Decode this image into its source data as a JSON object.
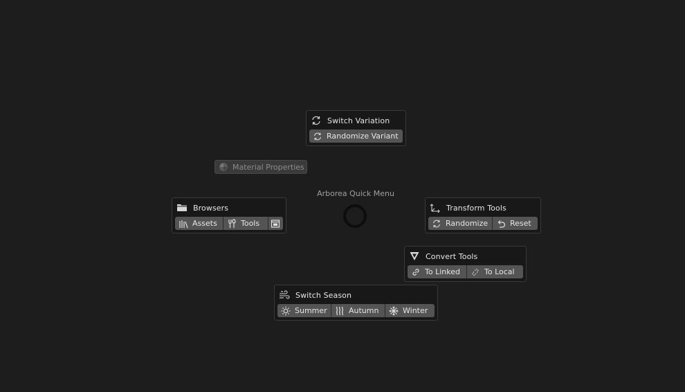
{
  "pie_menu": {
    "title": "Arborea Quick Menu"
  },
  "material_properties": {
    "label": "Material Properties"
  },
  "switch_variation": {
    "title": "Switch Variation",
    "randomize_label": "Randomize Variant"
  },
  "browsers": {
    "title": "Browsers",
    "assets_label": "Assets",
    "tools_label": "Tools"
  },
  "transform_tools": {
    "title": "Transform Tools",
    "randomize_label": "Randomize",
    "reset_label": "Reset"
  },
  "convert_tools": {
    "title": "Convert Tools",
    "to_linked_label": "To Linked",
    "to_local_label": "To Local"
  },
  "switch_season": {
    "title": "Switch Season",
    "summer_label": "Summer",
    "autumn_label": "Autumn",
    "winter_label": "Winter"
  },
  "colors": {
    "background": "#1d1d1d",
    "panel": "#181818",
    "button": "#545454",
    "disabled_button": "#3a3a3a"
  }
}
